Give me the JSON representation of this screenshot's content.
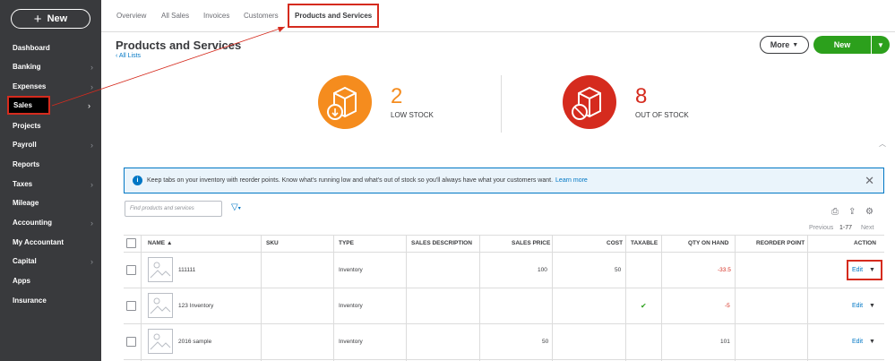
{
  "sidebar": {
    "new_label": "New",
    "items": [
      {
        "label": "Dashboard",
        "chevron": false
      },
      {
        "label": "Banking",
        "chevron": true
      },
      {
        "label": "Expenses",
        "chevron": true
      },
      {
        "label": "Sales",
        "chevron": true
      },
      {
        "label": "Projects",
        "chevron": false
      },
      {
        "label": "Payroll",
        "chevron": true
      },
      {
        "label": "Reports",
        "chevron": false
      },
      {
        "label": "Taxes",
        "chevron": true
      },
      {
        "label": "Mileage",
        "chevron": false
      },
      {
        "label": "Accounting",
        "chevron": true
      },
      {
        "label": "My Accountant",
        "chevron": false
      },
      {
        "label": "Capital",
        "chevron": true
      },
      {
        "label": "Apps",
        "chevron": false
      },
      {
        "label": "Insurance",
        "chevron": false
      }
    ]
  },
  "tabs": [
    "Overview",
    "All Sales",
    "Invoices",
    "Customers",
    "Products and Services"
  ],
  "header": {
    "title": "Products and Services",
    "back_link": "All Lists",
    "more_label": "More",
    "new_label": "New"
  },
  "stats": {
    "low": {
      "value": "2",
      "label": "LOW STOCK",
      "color": "#f58c1e"
    },
    "out": {
      "value": "8",
      "label": "OUT OF STOCK",
      "color": "#d52b1e"
    }
  },
  "info": {
    "text": "Keep tabs on your inventory with reorder points. Know what's running low and what's out of stock so you'll always have what your customers want.",
    "link": "Learn more"
  },
  "search": {
    "placeholder": "Find products and services"
  },
  "pager": {
    "previous": "Previous",
    "range": "1-77",
    "next": "Next"
  },
  "table": {
    "headers": [
      "NAME ▲",
      "SKU",
      "TYPE",
      "SALES DESCRIPTION",
      "SALES PRICE",
      "COST",
      "TAXABLE",
      "QTY ON HAND",
      "REORDER POINT",
      "ACTION"
    ],
    "rows": [
      {
        "name": "111111",
        "sku": "",
        "type": "Inventory",
        "desc": "",
        "price": "100",
        "cost": "50",
        "taxable": false,
        "qty": "-33.5",
        "reorder": "",
        "action": "Edit"
      },
      {
        "name": "123 Inventory",
        "sku": "",
        "type": "Inventory",
        "desc": "",
        "price": "",
        "cost": "",
        "taxable": true,
        "qty": "-5",
        "reorder": "",
        "action": "Edit"
      },
      {
        "name": "2016 sample",
        "sku": "",
        "type": "Inventory",
        "desc": "",
        "price": "50",
        "cost": "",
        "taxable": false,
        "qty": "101",
        "reorder": "",
        "action": "Edit"
      }
    ]
  },
  "colors": {
    "accent": "#0077c5",
    "green": "#2ca01c",
    "highlight": "#d52b1e",
    "sidebar": "#393a3d"
  }
}
